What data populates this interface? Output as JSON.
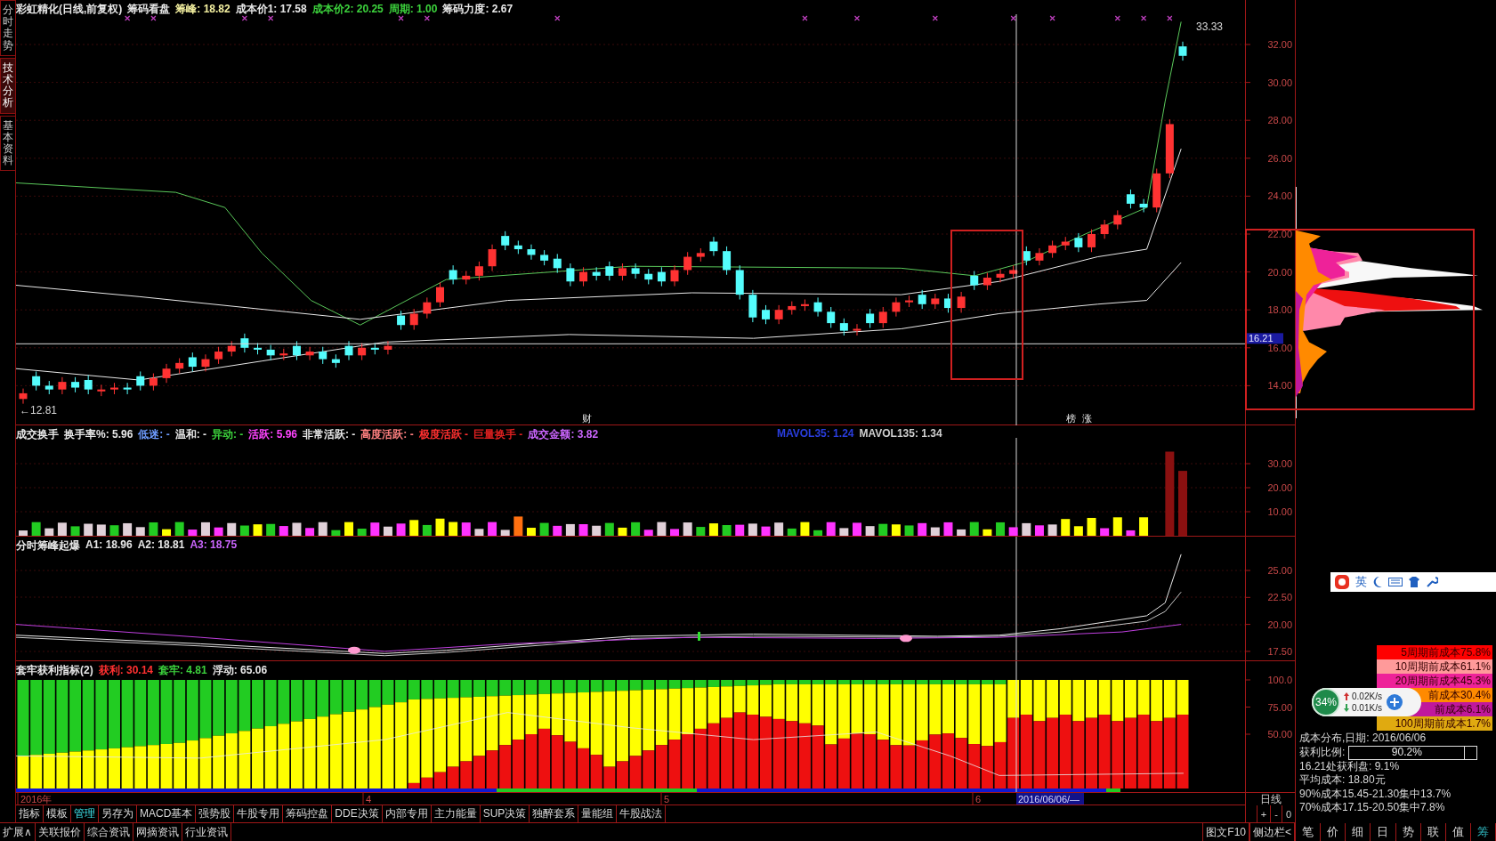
{
  "side_tabs": [
    {
      "label": "分时走势",
      "selected": false
    },
    {
      "label": "技术分析",
      "selected": true
    },
    {
      "label": "基本资料",
      "selected": false
    }
  ],
  "main_panel": {
    "legend": [
      {
        "text": "彩虹精化(日线,前复权)",
        "color": "#e8e8e8"
      },
      {
        "text": "筹码看盘",
        "color": "#e8e8e8"
      },
      {
        "text": "筹峰: 18.82",
        "color": "#f4f0a0"
      },
      {
        "text": "成本价1: 17.58",
        "color": "#e8e8e8"
      },
      {
        "text": "成本价2: 20.25",
        "color": "#3cd23c"
      },
      {
        "text": "周期: 1.00",
        "color": "#3cd23c"
      },
      {
        "text": "筹码力度: 2.67",
        "color": "#e8e8e8"
      }
    ],
    "high_label": "33.33",
    "low_label": "←12.81",
    "event_marks": [
      "财",
      "榜",
      "涨"
    ],
    "price_axis": [
      "32.00",
      "30.00",
      "28.00",
      "26.00",
      "24.00",
      "22.00",
      "20.00",
      "18.00",
      "16.00",
      "14.00"
    ],
    "current_price_tag": "16.21"
  },
  "volume_panel": {
    "legend": [
      {
        "text": "成交换手",
        "color": "#e8e8e8"
      },
      {
        "text": "换手率%: 5.96",
        "color": "#e8e8e8"
      },
      {
        "text": "低迷: -",
        "color": "#6e9cff"
      },
      {
        "text": "温和: -",
        "color": "#e8e8e8"
      },
      {
        "text": "异动: -",
        "color": "#3cd23c"
      },
      {
        "text": "活跃: 5.96",
        "color": "#ff44ff"
      },
      {
        "text": "非常活跃: -",
        "color": "#e8e8e8"
      },
      {
        "text": "高度活跃: -",
        "color": "#ff8080"
      },
      {
        "text": "极度活跃 -",
        "color": "#ff3030"
      },
      {
        "text": "巨量换手 -",
        "color": "#e02020"
      },
      {
        "text": "成交金额: 3.82",
        "color": "#cc66ff"
      }
    ],
    "ma_legend": [
      {
        "text": "MAVOL35: 1.24",
        "color": "#2a3ee0"
      },
      {
        "text": "MAVOL135: 1.34",
        "color": "#d0d0d0"
      }
    ],
    "axis": [
      "30.00",
      "20.00",
      "10.00"
    ]
  },
  "peak_panel": {
    "legend": [
      {
        "text": "分时筹峰起爆",
        "color": "#e8e8e8"
      },
      {
        "text": "A1: 18.96",
        "color": "#e8e8e8"
      },
      {
        "text": "A2: 18.81",
        "color": "#e8e8e8"
      },
      {
        "text": "A3: 18.75",
        "color": "#cc66ff"
      }
    ],
    "axis": [
      "25.00",
      "22.50",
      "20.00",
      "17.50"
    ]
  },
  "profit_panel": {
    "legend": [
      {
        "text": "套牢获利指标(2)",
        "color": "#e8e8e8"
      },
      {
        "text": "获利: 30.14",
        "color": "#ff3030"
      },
      {
        "text": "套牢: 4.81",
        "color": "#3cd23c"
      },
      {
        "text": "浮动: 65.06",
        "color": "#e8e8e8"
      }
    ],
    "axis": [
      "100.0",
      "75.00",
      "50.00"
    ]
  },
  "date_axis": {
    "labels": [
      "2016年",
      "4",
      "5",
      "6"
    ],
    "cursor_date": "2016/06/06/—"
  },
  "period_label": "日线",
  "zoom_buttons": [
    "+",
    "-",
    "0"
  ],
  "indicator_tabs": [
    {
      "label": "指标",
      "selected": false
    },
    {
      "label": "模板",
      "selected": false
    },
    {
      "label": "管理",
      "selected": true
    },
    {
      "label": "另存为",
      "selected": false
    },
    {
      "label": "MACD基本",
      "selected": false
    },
    {
      "label": "强势股",
      "selected": false
    },
    {
      "label": "牛股专用",
      "selected": false
    },
    {
      "label": "筹码控盘",
      "selected": false
    },
    {
      "label": "DDE决策",
      "selected": false
    },
    {
      "label": "内部专用",
      "selected": false
    },
    {
      "label": "主力能量",
      "selected": false
    },
    {
      "label": "SUP决策",
      "selected": false
    },
    {
      "label": "独醉套系",
      "selected": false
    },
    {
      "label": "量能组",
      "selected": false
    },
    {
      "label": "牛股战法",
      "selected": false
    }
  ],
  "bottom_tabs": [
    "扩展∧",
    "关联报价",
    "综合资讯",
    "网摘资讯",
    "行业资讯"
  ],
  "bottom_right_buttons": [
    "图文F10",
    "侧边栏<"
  ],
  "side_panel": {
    "period_costs": [
      {
        "text": "5周期前成本75.8%",
        "color": "#ff0000"
      },
      {
        "text": "10周期前成本61.1%",
        "color": "#ff9a9a"
      },
      {
        "text": "20周期前成本45.3%",
        "color": "#ee2299"
      },
      {
        "text": "前成本30.4%",
        "color": "#ff8a00"
      },
      {
        "text": "前成本6.1%",
        "color": "#c0189c"
      },
      {
        "text": "100周期前成本1.7%",
        "color": "#e0aa10"
      }
    ],
    "date_line": "成本分布,日期: 2016/06/06",
    "profit_label": "获利比例:",
    "profit_value": "90.2%",
    "level": 0.902,
    "lines": [
      "16.21处获利盘: 9.1%",
      "平均成本: 18.80元",
      "90%成本15.45-21.30集中13.7%",
      "70%成本17.15-20.50集中7.8%"
    ],
    "tabs": [
      {
        "label": "笔",
        "selected": false
      },
      {
        "label": "价",
        "selected": false
      },
      {
        "label": "细",
        "selected": false
      },
      {
        "label": "日",
        "selected": false
      },
      {
        "label": "势",
        "selected": false
      },
      {
        "label": "联",
        "selected": false
      },
      {
        "label": "值",
        "selected": false
      },
      {
        "label": "筹",
        "selected": true
      }
    ]
  },
  "speed_widget": {
    "percent": "34%",
    "upload": "0.02K/s",
    "download": "0.01K/s"
  },
  "ime_bar": {
    "mode": "英"
  }
}
